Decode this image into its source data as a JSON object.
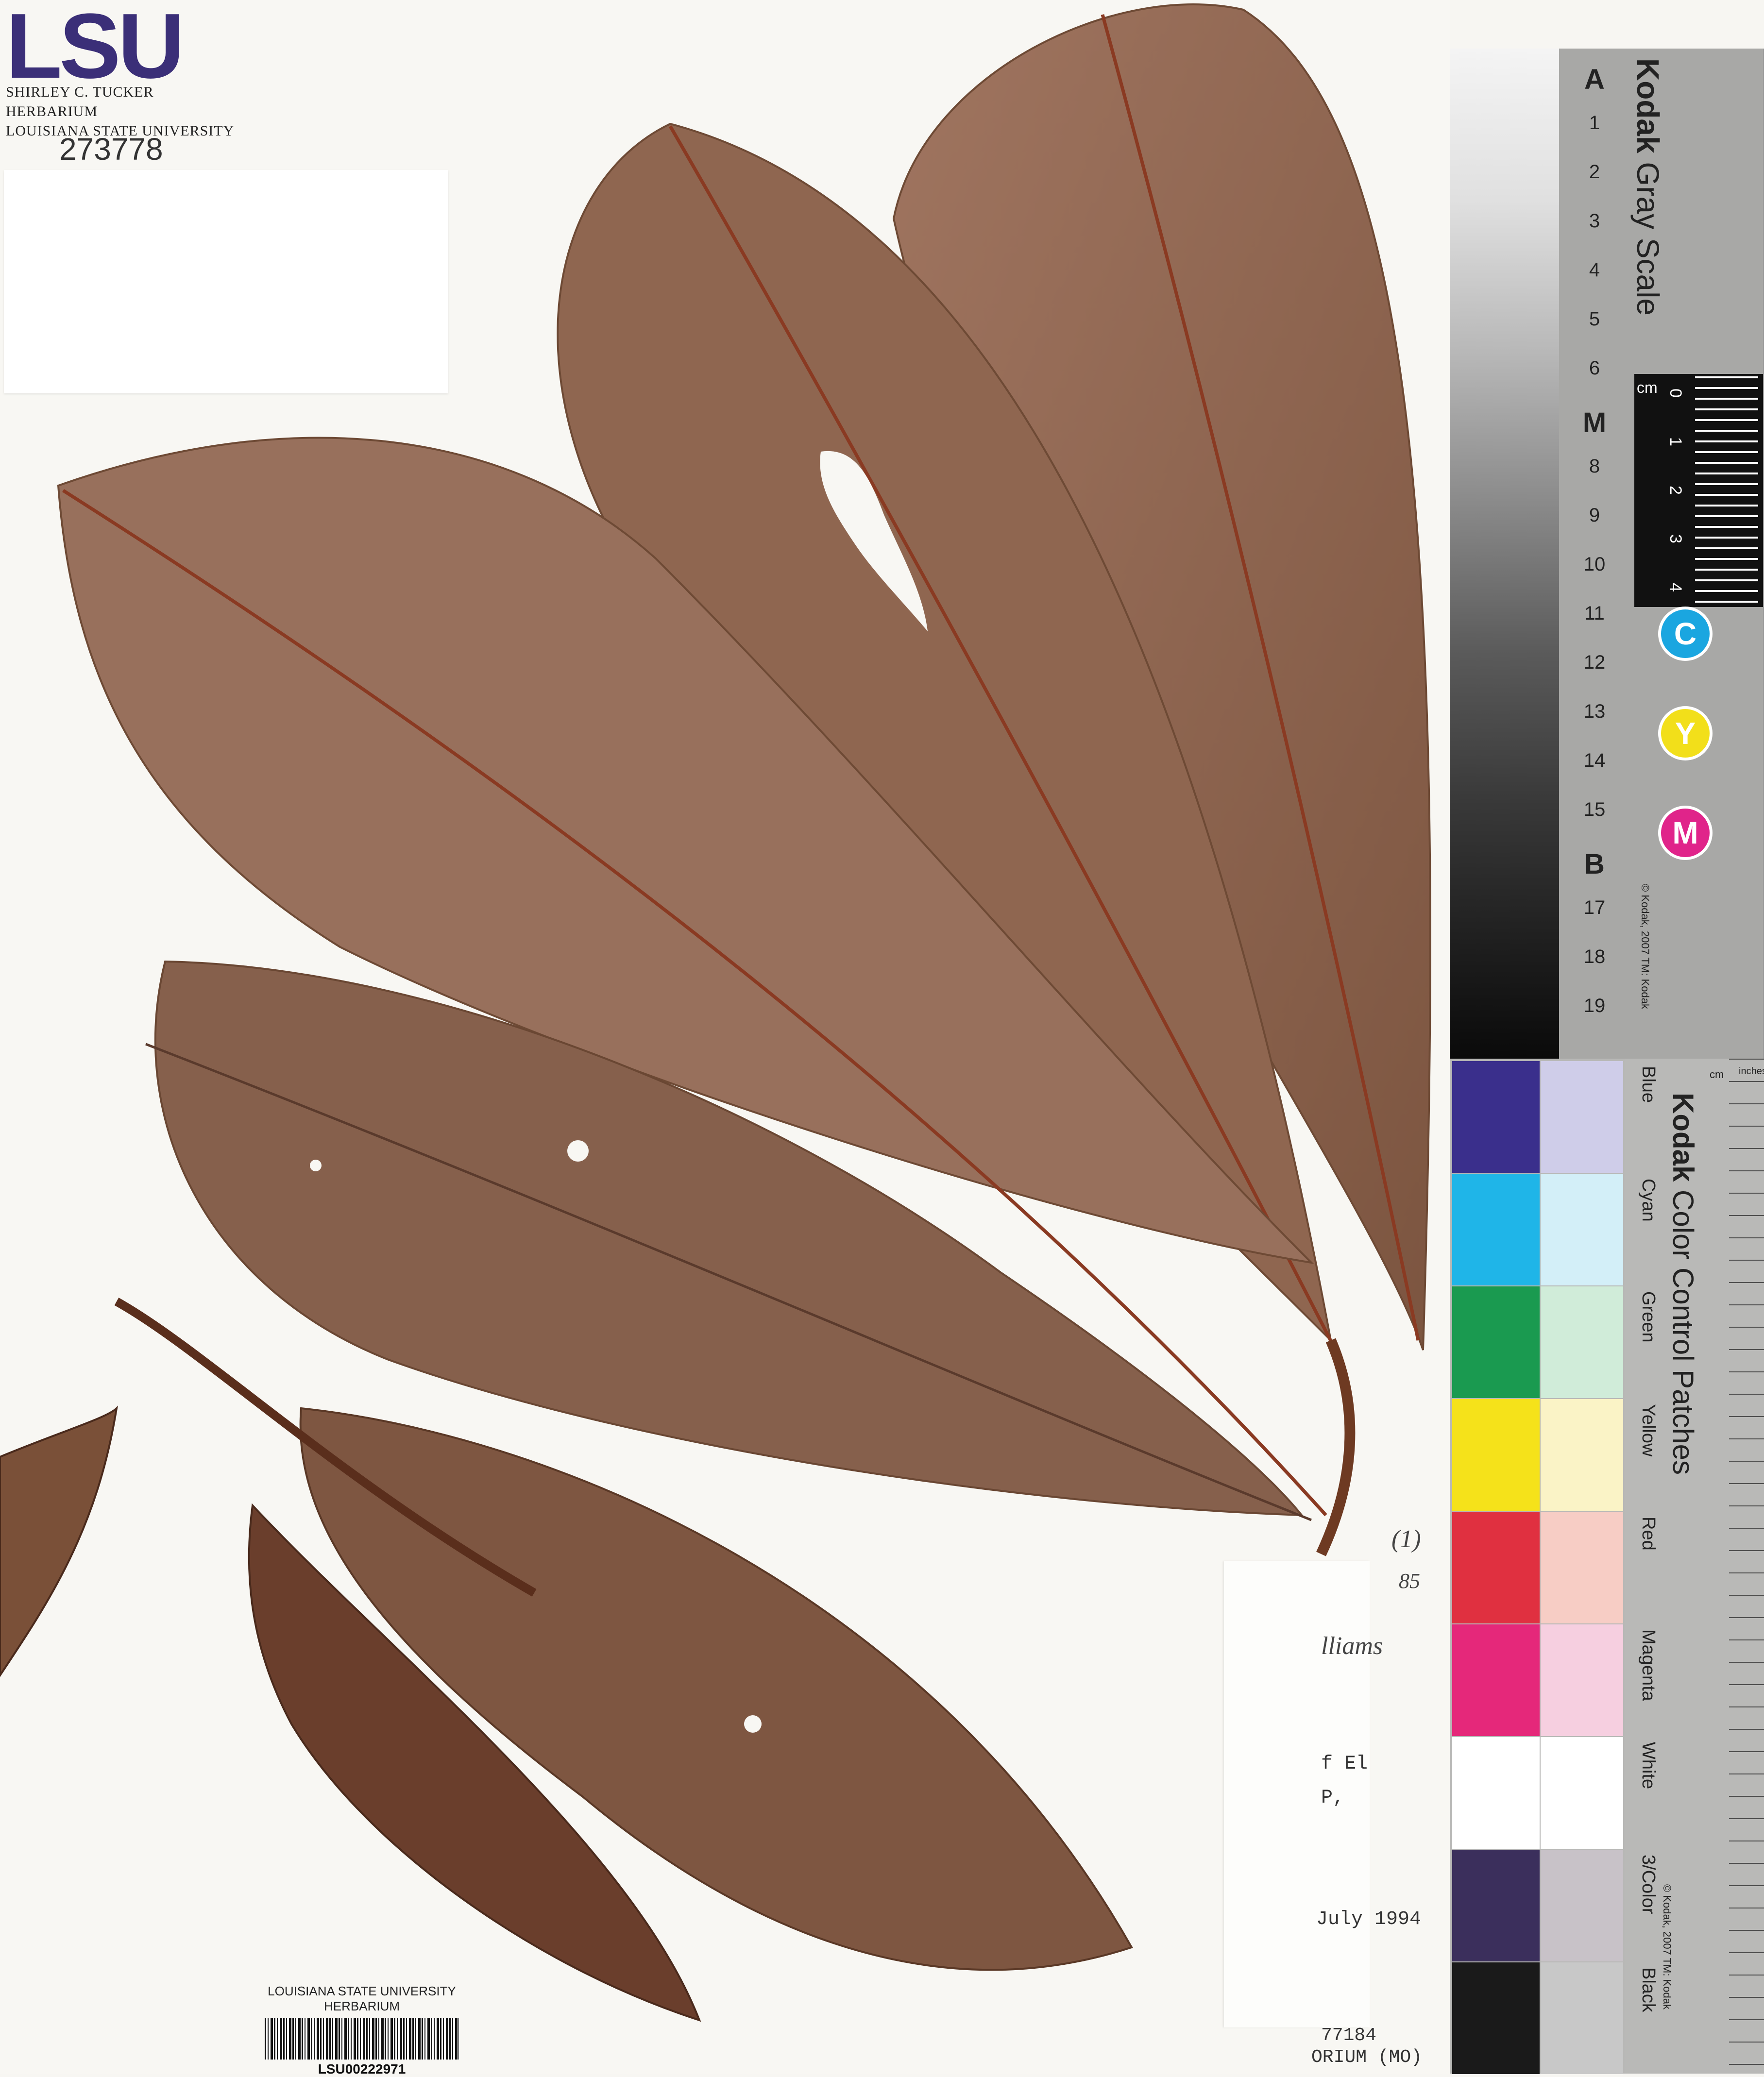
{
  "herbarium": {
    "logo": "LSU",
    "name_line1": "SHIRLEY C. TUCKER HERBARIUM",
    "name_line2": "LOUISIANA STATE UNIVERSITY",
    "catalog_number": "273778"
  },
  "barcode": {
    "title": "LOUISIANA STATE UNIVERSITY HERBARIUM",
    "id": "LSU00222971"
  },
  "label_fragments": {
    "hand_annotation_1": "(1)",
    "hand_annotation_2": "85",
    "species_fragment": "lliams",
    "line_1": "f El",
    "line_2": "P,",
    "date": "July 1994",
    "collection_no": "77184",
    "herbarium_line": "ORIUM (MO)"
  },
  "gray_scale_card": {
    "brand": "Kodak",
    "title": "Gray Scale",
    "steps": [
      "A",
      "1",
      "2",
      "3",
      "4",
      "5",
      "6",
      "M",
      "8",
      "9",
      "10",
      "11",
      "12",
      "13",
      "14",
      "15",
      "B",
      "17",
      "18",
      "19"
    ],
    "ruler_unit": "cm",
    "ruler_marks": [
      "0",
      "1",
      "2",
      "3",
      "4"
    ],
    "dots": [
      {
        "letter": "C",
        "color": "#1aa6e0"
      },
      {
        "letter": "Y",
        "color": "#f2df1a"
      },
      {
        "letter": "M",
        "color": "#e0248a"
      }
    ],
    "copyright": "© Kodak, 2007 TM: Kodak"
  },
  "color_card": {
    "brand": "Kodak",
    "title": "Color Control Patches",
    "unit_top": "cm",
    "unit_top2": "inches",
    "patches": [
      {
        "name": "Blue",
        "color": "#3a2f8c",
        "tint": "#cfcde9"
      },
      {
        "name": "Cyan",
        "color": "#1fb5e8",
        "tint": "#d3eff8"
      },
      {
        "name": "Green",
        "color": "#1a9a50",
        "tint": "#d0ecd9"
      },
      {
        "name": "Yellow",
        "color": "#f5e21a",
        "tint": "#faf3c6"
      },
      {
        "name": "Red",
        "color": "#e03040",
        "tint": "#f7cdc5"
      },
      {
        "name": "Magenta",
        "color": "#e5287a",
        "tint": "#f6cfe0"
      },
      {
        "name": "White",
        "color": "#ffffff",
        "tint": "#ffffff"
      },
      {
        "name": "3/Color",
        "color": "#3b2f5c",
        "tint": "#c8c2c8"
      },
      {
        "name": "Black",
        "color": "#1a1a1a",
        "tint": "#c8c8c8"
      }
    ],
    "copyright": "© Kodak, 2007 TM: Kodak"
  },
  "leaf_color": "#9a6e56"
}
